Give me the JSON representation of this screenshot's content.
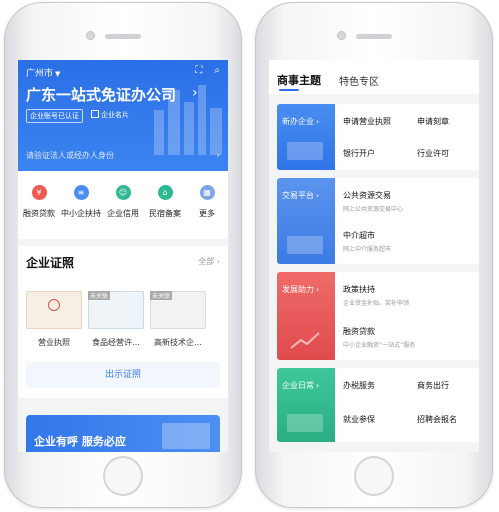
{
  "left_phone": {
    "city": "广州市",
    "company_name": "广东一站式免证办公司",
    "company_chevron": "›",
    "tag_verified": "企业账号已认证",
    "tag_card": "企业名片",
    "verify_link": "请验证法人或经办人身份",
    "verify_chevron": "›",
    "quick_items": [
      {
        "label": "融资贷款",
        "icon": "¥",
        "color": "#ee5a4f"
      },
      {
        "label": "中小企扶持",
        "icon": "≡",
        "color": "#4a8df0"
      },
      {
        "label": "企业信用",
        "icon": "☺",
        "color": "#2fb893"
      },
      {
        "label": "民宿备案",
        "icon": "⌂",
        "color": "#2fb893"
      },
      {
        "label": "更多",
        "icon": "▦",
        "color": "#7fa4e8"
      }
    ],
    "certs": {
      "title": "企业证照",
      "all_link": "全部 ›",
      "items": [
        {
          "label": "营业执照",
          "ribbon": ""
        },
        {
          "label": "食品经营许…",
          "ribbon": "未关联"
        },
        {
          "label": "高新技术企…",
          "ribbon": "未关联"
        }
      ],
      "show_button": "出示证照"
    },
    "banner_text": "企业有呼 服务必应"
  },
  "right_phone": {
    "tabs": {
      "active": "商事主题",
      "other": "特色专区"
    },
    "blocks": [
      {
        "side_label": "新办企业",
        "side_color": "#3d82ee",
        "type": "grid",
        "cells": [
          "申请营业执照",
          "申请刻章",
          "银行开户",
          "行业许可"
        ]
      },
      {
        "side_label": "交易平台",
        "side_color": "#4a86e6",
        "type": "list",
        "items": [
          {
            "title": "公共资源交易",
            "subtitle": "网上公共资源交易中心"
          },
          {
            "title": "中介超市",
            "subtitle": "网上中介服务超市"
          }
        ]
      },
      {
        "side_label": "发展助力",
        "side_color": "#e8585a",
        "type": "list",
        "items": [
          {
            "title": "政策扶持",
            "subtitle": "企业资金补贴、奖补申领"
          },
          {
            "title": "融资贷款",
            "subtitle": "中小企业融资“一站式”服务"
          }
        ]
      },
      {
        "side_label": "企业日常",
        "side_color": "#35bb8f",
        "type": "grid",
        "cells": [
          "办税服务",
          "商务出行",
          "就业参保",
          "招聘会报名"
        ]
      }
    ]
  }
}
